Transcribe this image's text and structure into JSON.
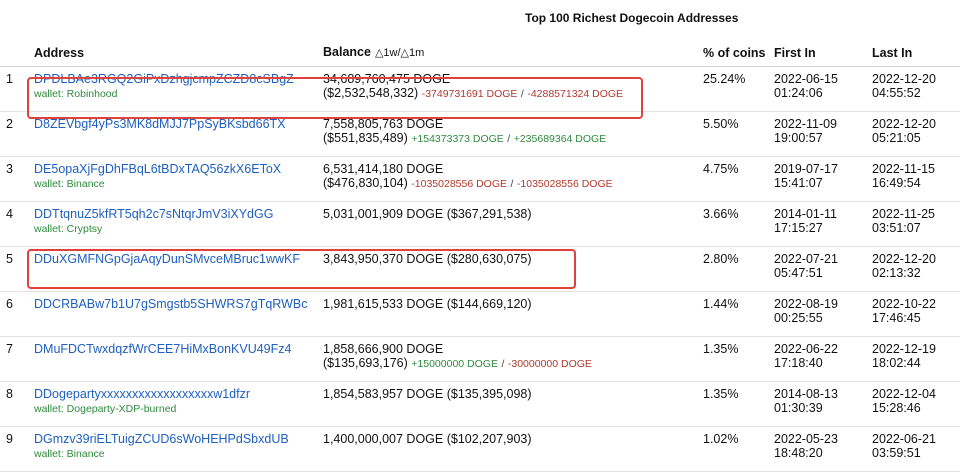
{
  "title": "Top 100 Richest Dogecoin Addresses",
  "columns": {
    "rank": "",
    "address": "Address",
    "balance": "Balance",
    "balance_sort": "△1w/△1m",
    "pct": "% of coins",
    "first_in": "First In",
    "last_in": "Last In"
  },
  "rows": [
    {
      "rank": "1",
      "address": "DPDLBAe3RGQ2GiPxDzhgjcmpZCZD8cSBgZ",
      "wallet": "wallet: Robinhood",
      "doge": "34,689,760,475 DOGE",
      "usd": "($2,532,548,332)",
      "d1w": "-3749731691 DOGE",
      "d1w_sign": "neg",
      "sep": "/",
      "d1m": "-4288571324 DOGE",
      "d1m_sign": "neg",
      "pct": "25.24%",
      "first_date": "2022-06-15",
      "first_time": "01:24:06",
      "last_date": "2022-12-20",
      "last_time": "04:55:52"
    },
    {
      "rank": "2",
      "address": "D8ZEVbgf4yPs3MK8dMJJ7PpSyBKsbd66TX",
      "wallet": "",
      "doge": "7,558,805,763 DOGE",
      "usd": "($551,835,489)",
      "d1w": "+154373373 DOGE",
      "d1w_sign": "pos",
      "sep": "/",
      "d1m": "+235689364 DOGE",
      "d1m_sign": "pos",
      "pct": "5.50%",
      "first_date": "2022-11-09",
      "first_time": "19:00:57",
      "last_date": "2022-12-20",
      "last_time": "05:21:05"
    },
    {
      "rank": "3",
      "address": "DE5opaXjFgDhFBqL6tBDxTAQ56zkX6EToX",
      "wallet": "wallet: Binance",
      "doge": "6,531,414,180 DOGE",
      "usd": "($476,830,104)",
      "d1w": "-1035028556 DOGE",
      "d1w_sign": "neg",
      "sep": "/",
      "d1m": "-1035028556 DOGE",
      "d1m_sign": "neg",
      "pct": "4.75%",
      "first_date": "2019-07-17",
      "first_time": "15:41:07",
      "last_date": "2022-11-15",
      "last_time": "16:49:54"
    },
    {
      "rank": "4",
      "address": "DDTtqnuZ5kfRT5qh2c7sNtqrJmV3iXYdGG",
      "wallet": "wallet: Cryptsy",
      "doge": "5,031,001,909 DOGE",
      "usd": "($367,291,538)",
      "d1w": "",
      "d1w_sign": "",
      "sep": "",
      "d1m": "",
      "d1m_sign": "",
      "pct": "3.66%",
      "first_date": "2014-01-11",
      "first_time": "17:15:27",
      "last_date": "2022-11-25",
      "last_time": "03:51:07"
    },
    {
      "rank": "5",
      "address": "DDuXGMFNGpGjaAqyDunSMvceMBruc1wwKF",
      "wallet": "",
      "doge": "3,843,950,370 DOGE",
      "usd": "($280,630,075)",
      "d1w": "",
      "d1w_sign": "",
      "sep": "",
      "d1m": "",
      "d1m_sign": "",
      "pct": "2.80%",
      "first_date": "2022-07-21",
      "first_time": "05:47:51",
      "last_date": "2022-12-20",
      "last_time": "02:13:32"
    },
    {
      "rank": "6",
      "address": "DDCRBABw7b1U7gSmgstb5SHWRS7gTqRWBc",
      "wallet": "",
      "doge": "1,981,615,533 DOGE",
      "usd": "($144,669,120)",
      "d1w": "",
      "d1w_sign": "",
      "sep": "",
      "d1m": "",
      "d1m_sign": "",
      "pct": "1.44%",
      "first_date": "2022-08-19",
      "first_time": "00:25:55",
      "last_date": "2022-10-22",
      "last_time": "17:46:45"
    },
    {
      "rank": "7",
      "address": "DMuFDCTwxdqzfWrCEE7HiMxBonKVU49Fz4",
      "wallet": "",
      "doge": "1,858,666,900 DOGE",
      "usd": "($135,693,176)",
      "d1w": "+15000000 DOGE",
      "d1w_sign": "pos",
      "sep": "/",
      "d1m": "-30000000 DOGE",
      "d1m_sign": "neg",
      "pct": "1.35%",
      "first_date": "2022-06-22",
      "first_time": "17:18:40",
      "last_date": "2022-12-19",
      "last_time": "18:02:44"
    },
    {
      "rank": "8",
      "address": "DDogepartyxxxxxxxxxxxxxxxxxxw1dfzr",
      "wallet": "wallet: Dogeparty-XDP-burned",
      "doge": "1,854,583,957 DOGE",
      "usd": "($135,395,098)",
      "d1w": "",
      "d1w_sign": "",
      "sep": "",
      "d1m": "",
      "d1m_sign": "",
      "pct": "1.35%",
      "first_date": "2014-08-13",
      "first_time": "01:30:39",
      "last_date": "2022-12-04",
      "last_time": "15:28:46"
    },
    {
      "rank": "9",
      "address": "DGmzv39riELTuigZCUD6sWoHEHPdSbxdUB",
      "wallet": "wallet: Binance",
      "doge": "1,400,000,007 DOGE",
      "usd": "($102,207,903)",
      "d1w": "",
      "d1w_sign": "",
      "sep": "",
      "d1m": "",
      "d1m_sign": "",
      "pct": "1.02%",
      "first_date": "2022-05-23",
      "first_time": "18:48:20",
      "last_date": "2022-06-21",
      "last_time": "03:59:51"
    }
  ],
  "highlight_color": "#e0413a",
  "link_color": "#1f5fbf",
  "wallet_color": "#2e8b3d",
  "negative_color": "#b03a2e",
  "positive_color": "#2e8b3d"
}
